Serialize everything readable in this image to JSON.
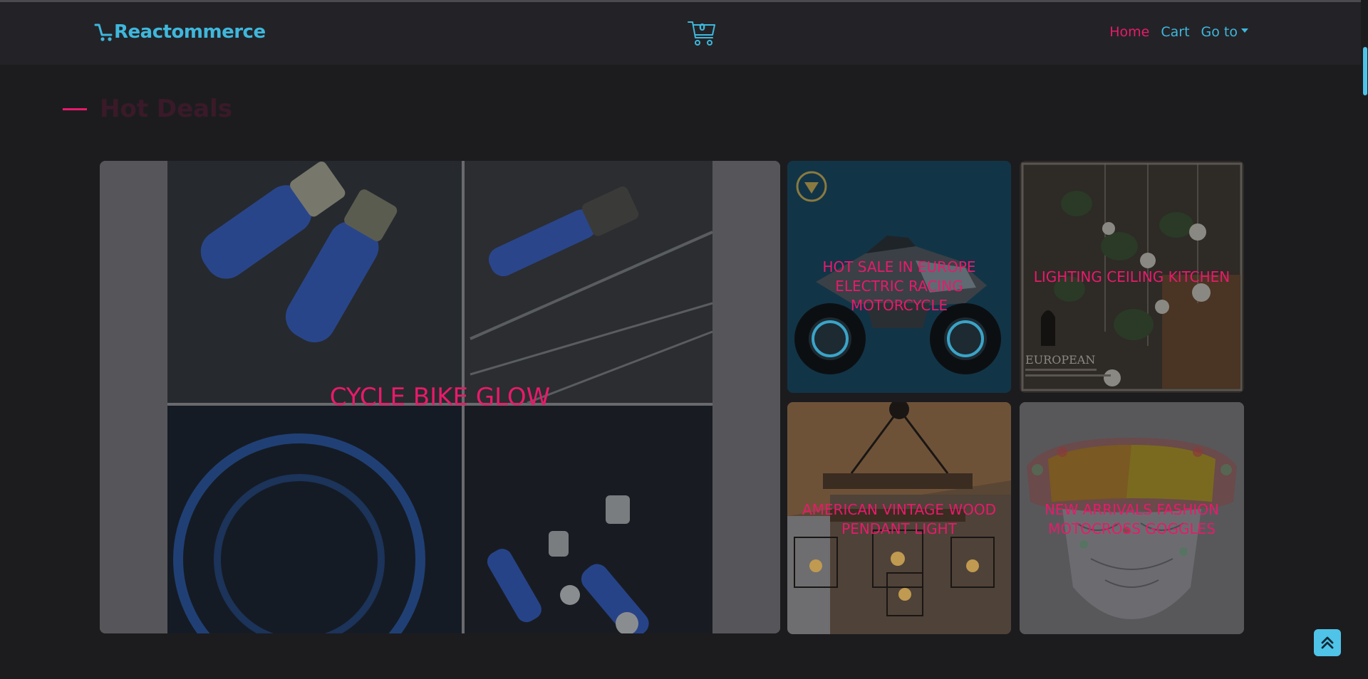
{
  "navbar": {
    "brand": "Reactommerce",
    "cart_count": "0",
    "links": [
      {
        "label": "Home",
        "active": true
      },
      {
        "label": "Cart",
        "active": false
      },
      {
        "label": "Go to",
        "active": false,
        "dropdown": true
      }
    ]
  },
  "section": {
    "title": "Hot Deals"
  },
  "deals": [
    {
      "title": "CYCLE BIKE GLOW"
    },
    {
      "title": "HOT SALE IN EUROPE ELECTRIC RACING MOTORCYCLE"
    },
    {
      "title": "LIGHTING CEILING KITCHEN"
    },
    {
      "title": "AMERICAN VINTAGE WOOD PENDANT LIGHT"
    },
    {
      "title": "NEW ARRIVALS FASHION MOTOCROSS GOGGLES"
    }
  ],
  "deal_images": {
    "light1_caption": "EUROPEAN"
  },
  "icons": {
    "brand": "shopping-cart-icon",
    "cart": "shopping-cart-icon",
    "scroll_top": "double-chevron-up-icon"
  },
  "colors": {
    "accent": "#e81a6b",
    "brand": "#3fb7dc",
    "navbar_bg": "#232327",
    "page_bg": "#1c1c1f"
  }
}
